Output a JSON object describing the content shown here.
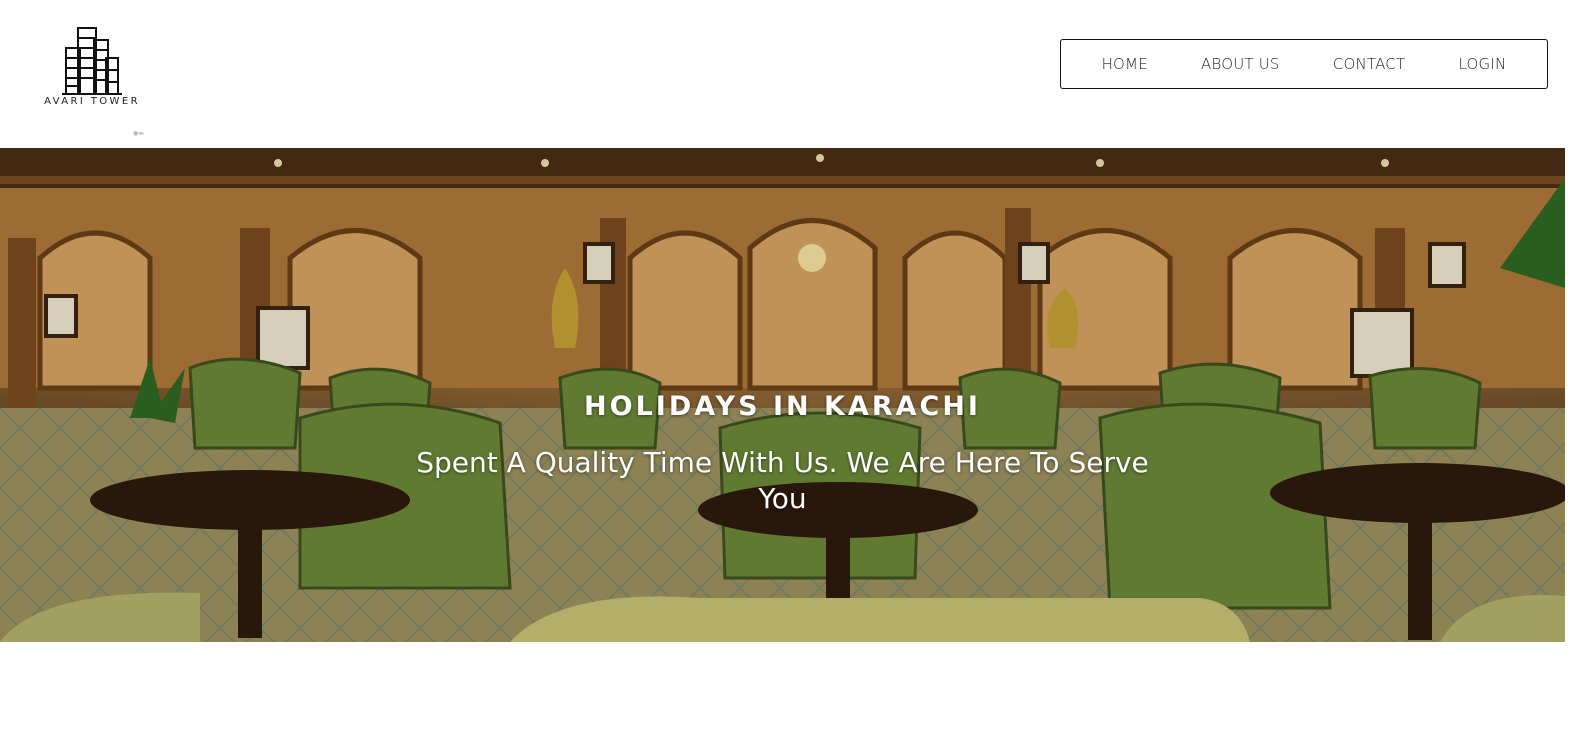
{
  "brand": {
    "name": "AVARI TOWER",
    "logo_icon": "building-icon"
  },
  "nav": {
    "items": [
      {
        "label": "HOME"
      },
      {
        "label": "ABOUT US"
      },
      {
        "label": "CONTACT"
      },
      {
        "label": "LOGIN"
      }
    ]
  },
  "hero": {
    "title": "HOLIDAYS IN KARACHI",
    "subtitle": "Spent A Quality Time With Us. We Are Here To Serve You",
    "background_image": "hotel-lounge-photo"
  },
  "colors": {
    "text_primary": "#222222",
    "hero_text": "#ffffff",
    "nav_border": "#111111"
  }
}
